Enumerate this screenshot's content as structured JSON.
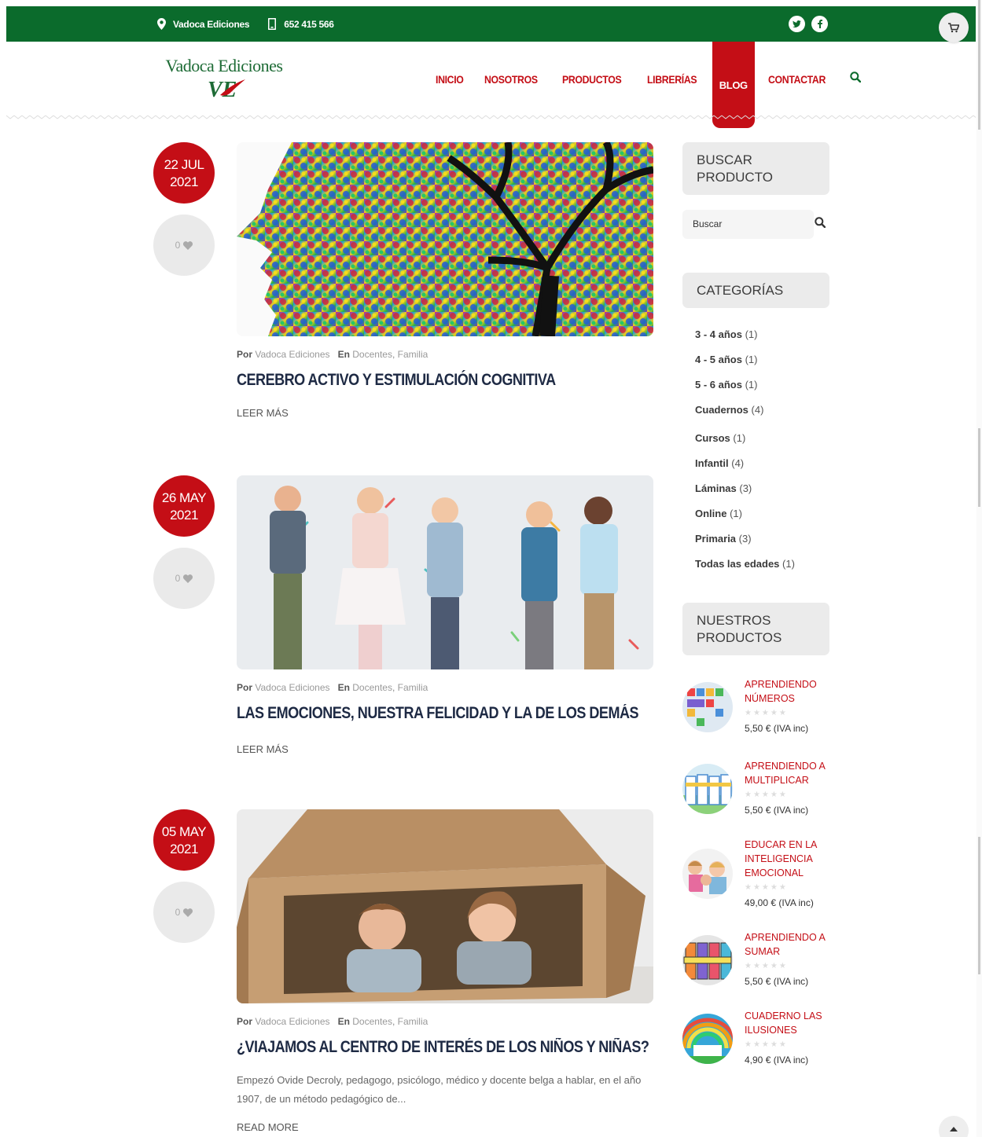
{
  "topbar": {
    "company": "Vadoca Ediciones",
    "phone": "652 415 566",
    "social": [
      "twitter-icon",
      "facebook-icon"
    ]
  },
  "header": {
    "logo_text": "Vadoca Ediciones",
    "logo_mark": "VE",
    "nav": [
      {
        "label": "INICIO"
      },
      {
        "label": "NOSOTROS"
      },
      {
        "label": "PRODUCTOS"
      },
      {
        "label": "LIBRERÍAS"
      },
      {
        "label": "BLOG",
        "active": true
      },
      {
        "label": "CONTACTAR"
      }
    ]
  },
  "posts": [
    {
      "day_month": "22 JUL",
      "year": "2021",
      "likes": "0",
      "by_label": "Por",
      "author": "Vadoca Ediciones",
      "in_label": "En",
      "cat1": "Docentes",
      "cat2": "Familia",
      "title": "CEREBRO ACTIVO Y ESTIMULACIÓN COGNITIVA",
      "more": "LEER MÁS"
    },
    {
      "day_month": "26 MAY",
      "year": "2021",
      "likes": "0",
      "by_label": "Por",
      "author": "Vadoca Ediciones",
      "in_label": "En",
      "cat1": "Docentes",
      "cat2": "Familia",
      "title": "LAS EMOCIONES, NUESTRA FELICIDAD Y LA DE LOS DEMÁS",
      "more": "LEER MÁS"
    },
    {
      "day_month": "05 MAY",
      "year": "2021",
      "likes": "0",
      "by_label": "Por",
      "author": "Vadoca Ediciones",
      "in_label": "En",
      "cat1": "Docentes",
      "cat2": "Familia",
      "title": "¿VIAJAMOS AL CENTRO DE INTERÉS DE LOS NIÑOS Y NIÑAS?",
      "excerpt": "Empezó Ovide Decroly, pedagogo, psicólogo, médico y docente belga a hablar, en el año 1907, de un método pedagógico de...",
      "more": "READ MORE"
    }
  ],
  "sidebar": {
    "search_title": "BUSCAR PRODUCTO",
    "search_placeholder": "Buscar",
    "categories_title": "CATEGORÍAS",
    "categories": [
      {
        "name": "3 - 4 años",
        "count": "(1)"
      },
      {
        "name": "4 - 5 años",
        "count": "(1)"
      },
      {
        "name": "5 - 6 años",
        "count": "(1)"
      },
      {
        "name": "Cuadernos",
        "count": "(4)"
      },
      {
        "name": "Cursos",
        "count": "(1)"
      },
      {
        "name": "Infantil",
        "count": "(4)"
      },
      {
        "name": "Láminas",
        "count": "(3)"
      },
      {
        "name": "Online",
        "count": "(1)"
      },
      {
        "name": "Primaria",
        "count": "(3)"
      },
      {
        "name": "Todas las edades",
        "count": "(1)"
      }
    ],
    "products_title": "NUESTROS PRODUCTOS",
    "products": [
      {
        "name": "APRENDIENDO NÚMEROS",
        "price": "5,50 € (IVA inc)",
        "rating": 0
      },
      {
        "name": "APRENDIENDO A MULTIPLICAR",
        "price": "5,50 € (IVA inc)",
        "rating": 0
      },
      {
        "name": "EDUCAR EN LA INTELIGENCIA EMOCIONAL",
        "price": "49,00 € (IVA inc)",
        "rating": 0
      },
      {
        "name": "APRENDIENDO A SUMAR",
        "price": "5,50 € (IVA inc)",
        "rating": 0
      },
      {
        "name": "CUADERNO LAS ILUSIONES",
        "price": "4,90 € (IVA inc)",
        "rating": 0
      }
    ]
  },
  "colors": {
    "topbar_green": "#0b6b2c",
    "accent_red": "#c40e16",
    "title_navy": "#1e2a44"
  }
}
